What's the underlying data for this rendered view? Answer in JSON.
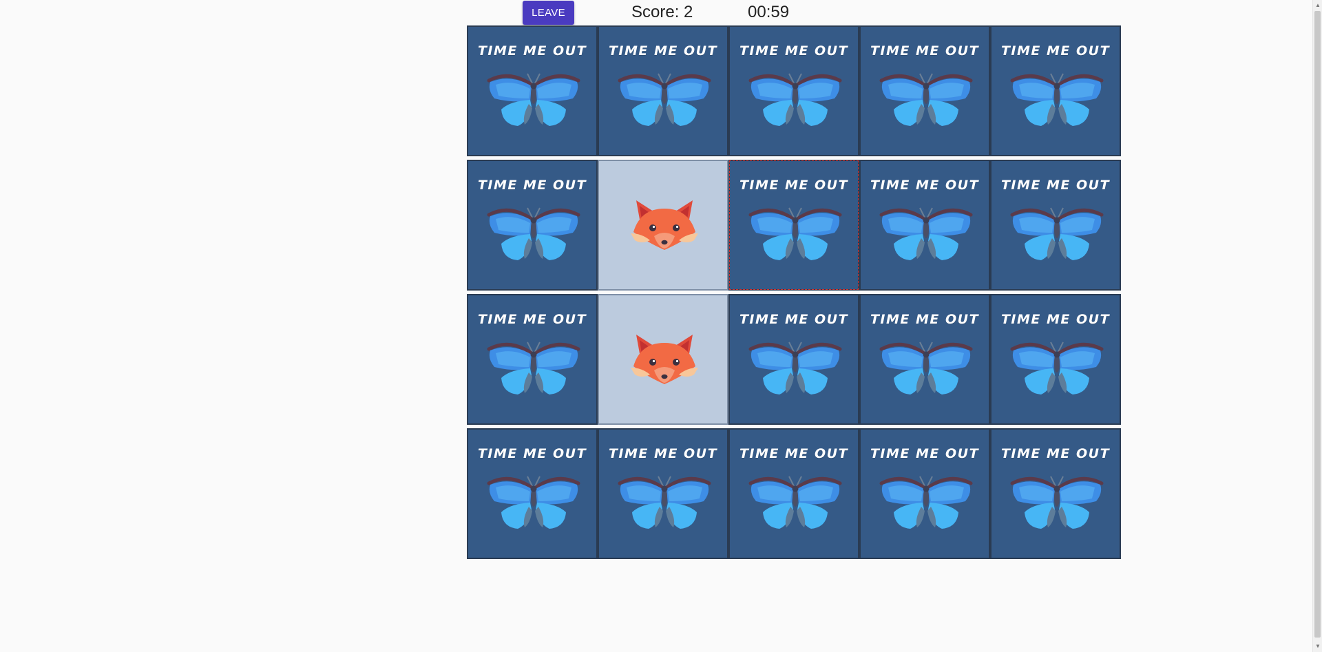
{
  "header": {
    "leave_label": "LEAVE",
    "score_text": "Score: 2",
    "timer_text": "00:59"
  },
  "board": {
    "card_back_title": "TIME ME OUT",
    "card_back_icon": "butterfly-icon",
    "rows": [
      [
        "back",
        "back",
        "back",
        "back",
        "back"
      ],
      [
        "back",
        "fox",
        "back",
        "back",
        "back"
      ],
      [
        "back",
        "fox",
        "back",
        "back",
        "back"
      ],
      [
        "back",
        "back",
        "back",
        "back",
        "back"
      ]
    ],
    "focused_card": {
      "row": 2,
      "col": 3
    }
  },
  "colors": {
    "leave_button": "#4a3bc0",
    "card_back": "#355a87",
    "card_face": "#bccbde",
    "focus_outline": "#d0312d"
  }
}
